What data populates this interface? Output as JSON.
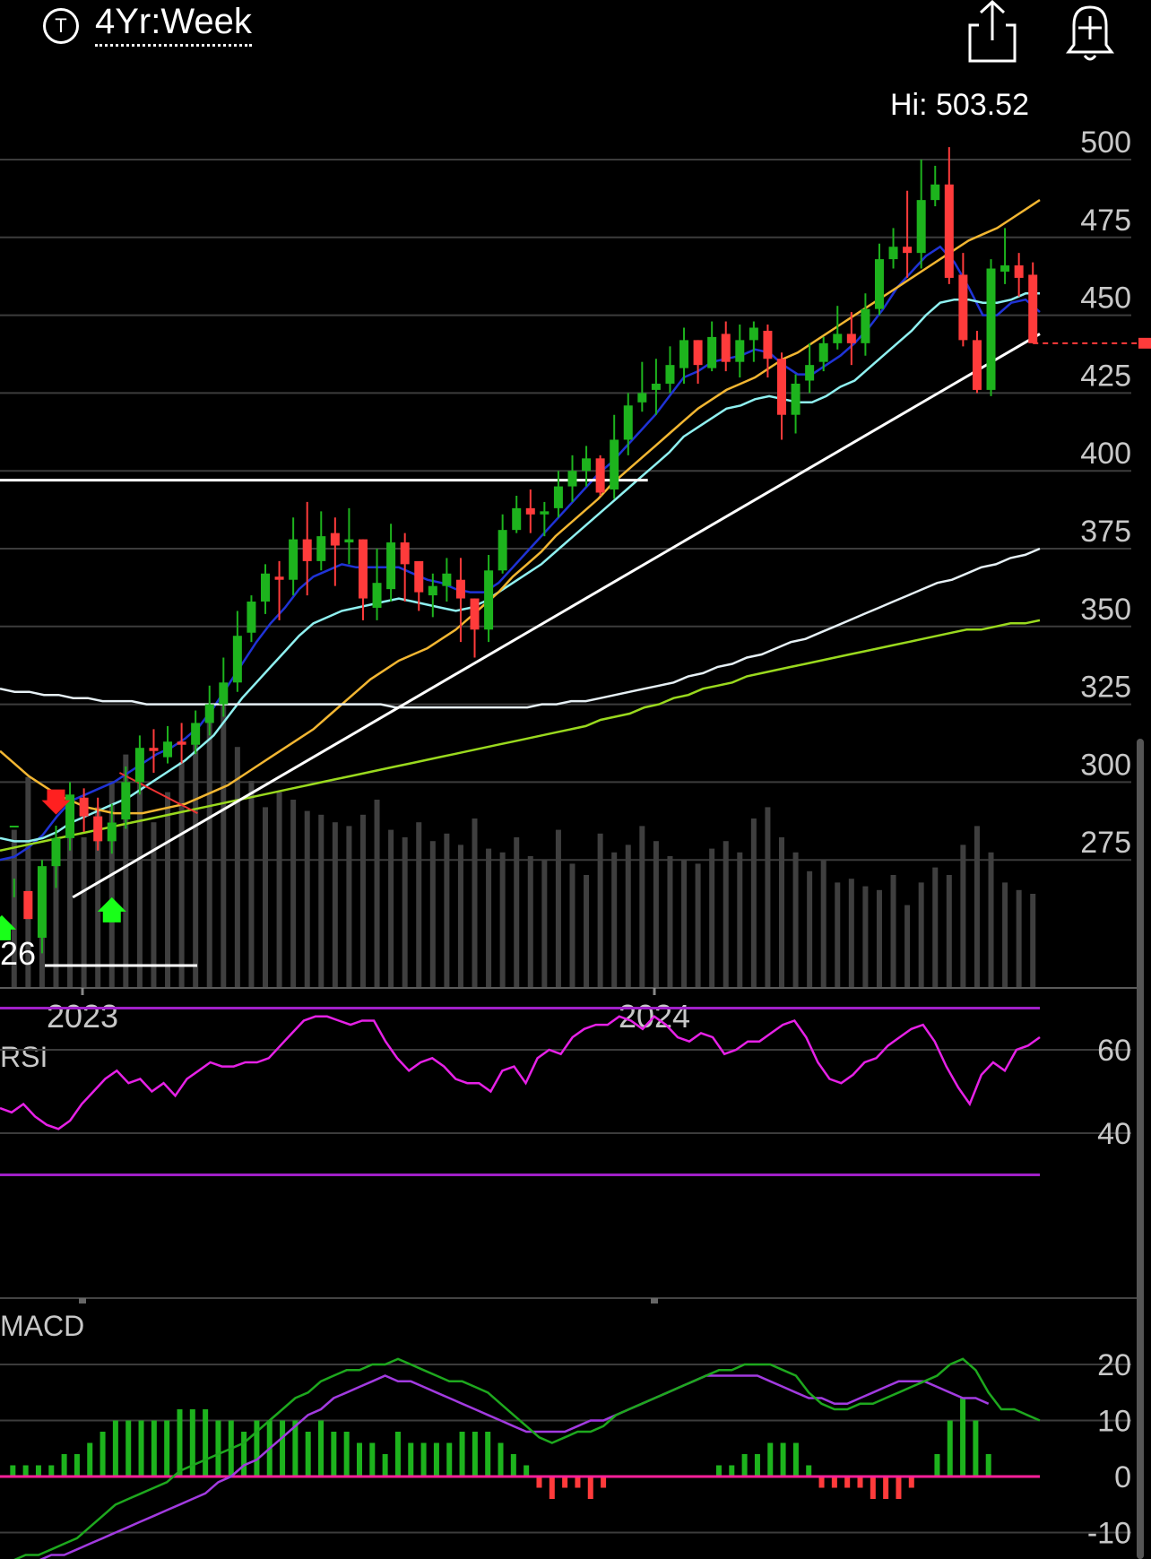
{
  "header": {
    "ticker_icon": "T",
    "period": "4Yr:Week",
    "share_icon": "share-icon",
    "alert_icon": "bell-add-icon"
  },
  "colors": {
    "background": "#000000",
    "up_candle": "#1db31d",
    "down_candle": "#ff3b3b",
    "ma_fast": "#1f33d6",
    "ma_mid": "#8ff0f0",
    "ma_50": "#f2b632",
    "ma_100": "#e6f0f5",
    "ma_200": "#9ad91e",
    "rsi_line": "#e621e6",
    "rsi_band": "#a020c8",
    "macd_line": "#1ea81e",
    "macd_signal": "#a23be0",
    "macd_zero": "#ff1f9a"
  },
  "chart_data": [
    {
      "type": "candlestick",
      "title": "",
      "hi_label": "Hi: 503.52",
      "y_ticks": [
        500,
        475,
        450,
        425,
        400,
        375,
        350,
        325,
        300,
        275
      ],
      "x_ticks": [
        "2023",
        "2024"
      ],
      "left_label": "26",
      "candles": [
        [
          286,
          286,
          269,
          263
        ],
        [
          265,
          256,
          248,
          248
        ],
        [
          250,
          273,
          275,
          245
        ],
        [
          273,
          282,
          286,
          266
        ],
        [
          282,
          296,
          300,
          278
        ],
        [
          295,
          289,
          298,
          284
        ],
        [
          289,
          281,
          295,
          278
        ],
        [
          281,
          287,
          293,
          277
        ],
        [
          288,
          300,
          305,
          285
        ],
        [
          300,
          311,
          315,
          296
        ],
        [
          311,
          310,
          317,
          303
        ],
        [
          308,
          313,
          318,
          306
        ],
        [
          313,
          312,
          319,
          306
        ],
        [
          312,
          319,
          323,
          309
        ],
        [
          319,
          325,
          331,
          315
        ],
        [
          325,
          332,
          340,
          321
        ],
        [
          332,
          347,
          355,
          329
        ],
        [
          348,
          358,
          360,
          345
        ],
        [
          358,
          367,
          370,
          354
        ],
        [
          366,
          365,
          371,
          352
        ],
        [
          365,
          378,
          385,
          360
        ],
        [
          378,
          371,
          390,
          360
        ],
        [
          371,
          379,
          387,
          368
        ],
        [
          380,
          376,
          385,
          363
        ],
        [
          377,
          378,
          388,
          370
        ],
        [
          378,
          359,
          378,
          352
        ],
        [
          356,
          364,
          375,
          352
        ],
        [
          362,
          377,
          383,
          358
        ],
        [
          377,
          370,
          380,
          358
        ],
        [
          371,
          361,
          366,
          355
        ],
        [
          360,
          363,
          367,
          353
        ],
        [
          363,
          367,
          372,
          358
        ],
        [
          365,
          359,
          372,
          345
        ],
        [
          359,
          349,
          359,
          340
        ],
        [
          349,
          368,
          373,
          345
        ],
        [
          368,
          381,
          386,
          367
        ],
        [
          381,
          388,
          392,
          380
        ],
        [
          388,
          386,
          394,
          380
        ],
        [
          386,
          387,
          390,
          379
        ],
        [
          388,
          395,
          400,
          385
        ],
        [
          395,
          400,
          405,
          390
        ],
        [
          400,
          404,
          408,
          395
        ],
        [
          404,
          393,
          405,
          392
        ],
        [
          394,
          410,
          418,
          391
        ],
        [
          410,
          421,
          425,
          405
        ],
        [
          422,
          425,
          435,
          419
        ],
        [
          426,
          428,
          436,
          418
        ],
        [
          428,
          434,
          440,
          425
        ],
        [
          433,
          442,
          446,
          428
        ],
        [
          442,
          434,
          442,
          428
        ],
        [
          433,
          443,
          448,
          432
        ],
        [
          444,
          435,
          448,
          432
        ],
        [
          435,
          442,
          447,
          430
        ],
        [
          442,
          446,
          448,
          435
        ],
        [
          445,
          436,
          447,
          430
        ],
        [
          436,
          418,
          438,
          410
        ],
        [
          418,
          428,
          431,
          412
        ],
        [
          429,
          434,
          441,
          425
        ],
        [
          435,
          441,
          443,
          432
        ],
        [
          441,
          444,
          453,
          439
        ],
        [
          444,
          441,
          451,
          434
        ],
        [
          441,
          452,
          457,
          437
        ],
        [
          452,
          468,
          473,
          450
        ],
        [
          468,
          472,
          478,
          465
        ],
        [
          472,
          470,
          490,
          462
        ],
        [
          470,
          487,
          500,
          465
        ],
        [
          487,
          492,
          498,
          485
        ],
        [
          492,
          462,
          504,
          460
        ],
        [
          463,
          442,
          470,
          440
        ],
        [
          442,
          426,
          445,
          425
        ],
        [
          426,
          465,
          468,
          424
        ],
        [
          464,
          466,
          478,
          460
        ],
        [
          466,
          462,
          470,
          456
        ],
        [
          463,
          441,
          467,
          441
        ]
      ],
      "volumes": [
        0.42,
        0.56,
        0.3,
        0.35,
        0.46,
        0.4,
        0.48,
        0.55,
        0.62,
        0.58,
        0.44,
        0.52,
        0.6,
        0.66,
        0.72,
        0.78,
        0.64,
        0.55,
        0.48,
        0.52,
        0.5,
        0.47,
        0.46,
        0.44,
        0.43,
        0.46,
        0.5,
        0.42,
        0.4,
        0.44,
        0.39,
        0.41,
        0.38,
        0.45,
        0.37,
        0.36,
        0.4,
        0.35,
        0.34,
        0.42,
        0.33,
        0.3,
        0.41,
        0.36,
        0.38,
        0.43,
        0.39,
        0.35,
        0.34,
        0.33,
        0.37,
        0.39,
        0.36,
        0.45,
        0.48,
        0.4,
        0.36,
        0.31,
        0.34,
        0.28,
        0.29,
        0.27,
        0.26,
        0.3,
        0.22,
        0.28,
        0.32,
        0.3,
        0.38,
        0.43,
        0.36,
        0.28,
        0.26,
        0.25
      ],
      "series": [
        {
          "key": "ma_fast",
          "values": [
            275,
            276,
            279,
            283,
            289,
            294,
            296,
            298,
            300,
            303,
            306,
            309,
            311,
            314,
            318,
            324,
            331,
            338,
            345,
            351,
            356,
            362,
            366,
            368,
            370,
            369,
            369,
            369,
            369,
            367,
            365,
            364,
            362,
            361,
            361,
            364,
            369,
            374,
            379,
            384,
            389,
            394,
            399,
            403,
            408,
            413,
            418,
            424,
            430,
            432,
            435,
            436,
            437,
            439,
            438,
            434,
            431,
            431,
            434,
            437,
            441,
            446,
            452,
            459,
            464,
            469,
            472,
            467,
            459,
            450,
            450,
            454,
            455,
            451
          ]
        },
        {
          "key": "ma_mid",
          "values": [
            282,
            281,
            281,
            282,
            284,
            287,
            289,
            291,
            293,
            295,
            298,
            301,
            304,
            307,
            311,
            315,
            321,
            327,
            332,
            337,
            342,
            347,
            351,
            353,
            355,
            356,
            357,
            358,
            359,
            358,
            357,
            356,
            355,
            356,
            358,
            361,
            364,
            367,
            370,
            374,
            378,
            382,
            386,
            390,
            394,
            398,
            402,
            406,
            411,
            414,
            417,
            420,
            421,
            423,
            424,
            423,
            422,
            422,
            424,
            427,
            429,
            433,
            437,
            441,
            445,
            450,
            454,
            455,
            455,
            454,
            454,
            455,
            457,
            457
          ]
        },
        {
          "key": "ma_50",
          "values": [
            310,
            306,
            302,
            299,
            296,
            294,
            292,
            291,
            290,
            290,
            290,
            291,
            292,
            293,
            295,
            297,
            299,
            302,
            305,
            308,
            311,
            314,
            317,
            321,
            325,
            329,
            333,
            336,
            339,
            341,
            343,
            346,
            349,
            353,
            357,
            361,
            366,
            370,
            374,
            379,
            383,
            387,
            391,
            396,
            400,
            404,
            408,
            412,
            416,
            420,
            423,
            426,
            428,
            430,
            433,
            436,
            438,
            441,
            444,
            447,
            450,
            453,
            456,
            459,
            462,
            465,
            468,
            471,
            474,
            476,
            478,
            481,
            484,
            487
          ]
        },
        {
          "key": "ma_100",
          "values": [
            330,
            329,
            329,
            328,
            328,
            327,
            327,
            326,
            326,
            326,
            325,
            325,
            325,
            325,
            325,
            325,
            325,
            325,
            325,
            325,
            325,
            325,
            325,
            325,
            325,
            325,
            325,
            324,
            324,
            324,
            324,
            324,
            324,
            324,
            324,
            324,
            324,
            325,
            325,
            326,
            326,
            327,
            328,
            329,
            330,
            331,
            332,
            334,
            335,
            337,
            338,
            340,
            341,
            343,
            345,
            346,
            348,
            350,
            352,
            354,
            356,
            358,
            360,
            362,
            364,
            365,
            367,
            369,
            370,
            372,
            373,
            375
          ]
        },
        {
          "key": "ma_200",
          "values": [
            278,
            279,
            280,
            281,
            282,
            283,
            284,
            285,
            286,
            287,
            288,
            289,
            290,
            291,
            292,
            293,
            294,
            295,
            296,
            297,
            298,
            299,
            300,
            301,
            302,
            303,
            304,
            305,
            306,
            307,
            308,
            309,
            310,
            311,
            312,
            313,
            314,
            315,
            316,
            317,
            318,
            320,
            321,
            322,
            324,
            325,
            327,
            328,
            330,
            331,
            332,
            334,
            335,
            336,
            337,
            338,
            339,
            340,
            341,
            342,
            343,
            344,
            345,
            346,
            347,
            348,
            349,
            349,
            350,
            351,
            351,
            352
          ]
        }
      ],
      "trendlines": [
        {
          "from": [
            0.07,
            263
          ],
          "to": [
            1.0,
            444
          ]
        },
        {
          "from": [
            0.0,
            397
          ],
          "to": [
            0.623,
            397
          ]
        },
        {
          "from": [
            0.115,
            303
          ],
          "to": [
            0.19,
            290
          ]
        }
      ],
      "last_price": 441,
      "signals": [
        {
          "type": "sell",
          "index": 3
        },
        {
          "type": "buy",
          "index": 7
        },
        {
          "type": "buy",
          "index": 0
        }
      ]
    },
    {
      "type": "line",
      "name": "RSI",
      "y_ticks": [
        60,
        40
      ],
      "bands": [
        70,
        30
      ],
      "values": [
        46,
        45,
        47,
        44,
        42,
        41,
        43,
        47,
        50,
        53,
        55,
        52,
        53,
        50,
        52,
        49,
        53,
        55,
        57,
        56,
        56,
        57,
        57,
        58,
        61,
        64,
        67,
        68,
        68,
        67,
        66,
        67,
        67,
        62,
        58,
        55,
        57,
        58,
        56,
        53,
        52,
        52,
        50,
        55,
        56,
        52,
        58,
        60,
        59,
        63,
        65,
        66,
        66,
        68,
        67,
        65,
        68,
        66,
        63,
        62,
        64,
        63,
        59,
        60,
        62,
        62,
        64,
        66,
        67,
        63,
        57,
        53,
        52,
        54,
        57,
        58,
        61,
        63,
        65,
        66,
        62,
        56,
        51,
        47,
        54,
        57,
        55,
        60,
        61,
        63
      ]
    },
    {
      "type": "bar+line",
      "name": "MACD",
      "y_ticks": [
        20,
        10,
        0,
        -10
      ],
      "macd": [
        -16,
        -15,
        -14,
        -14,
        -13,
        -12,
        -11,
        -9,
        -7,
        -5,
        -4,
        -3,
        -2,
        -1,
        1,
        2,
        3,
        4,
        5,
        6,
        8,
        10,
        12,
        14,
        15,
        17,
        18,
        19,
        19,
        20,
        20,
        21,
        20,
        19,
        18,
        17,
        17,
        16,
        15,
        13,
        11,
        9,
        7,
        6,
        7,
        8,
        8,
        9,
        11,
        12,
        13,
        14,
        15,
        16,
        17,
        18,
        19,
        19,
        20,
        20,
        20,
        19,
        18,
        15,
        13,
        12,
        12,
        13,
        13,
        14,
        15,
        16,
        17,
        18,
        20,
        21,
        19,
        15,
        12,
        12,
        11,
        10
      ],
      "signal": [
        -16,
        -16,
        -15,
        -15,
        -14,
        -14,
        -13,
        -12,
        -11,
        -10,
        -9,
        -8,
        -7,
        -6,
        -5,
        -4,
        -3,
        -1,
        0,
        2,
        3,
        5,
        7,
        9,
        11,
        12,
        14,
        15,
        16,
        17,
        18,
        17,
        17,
        16,
        15,
        14,
        13,
        12,
        11,
        10,
        9,
        8,
        8,
        8,
        8,
        9,
        10,
        10,
        11,
        12,
        13,
        14,
        15,
        16,
        17,
        18,
        18,
        18,
        18,
        18,
        17,
        16,
        15,
        14,
        14,
        13,
        13,
        14,
        15,
        16,
        17,
        17,
        17,
        16,
        15,
        14,
        14,
        13
      ]
    }
  ]
}
